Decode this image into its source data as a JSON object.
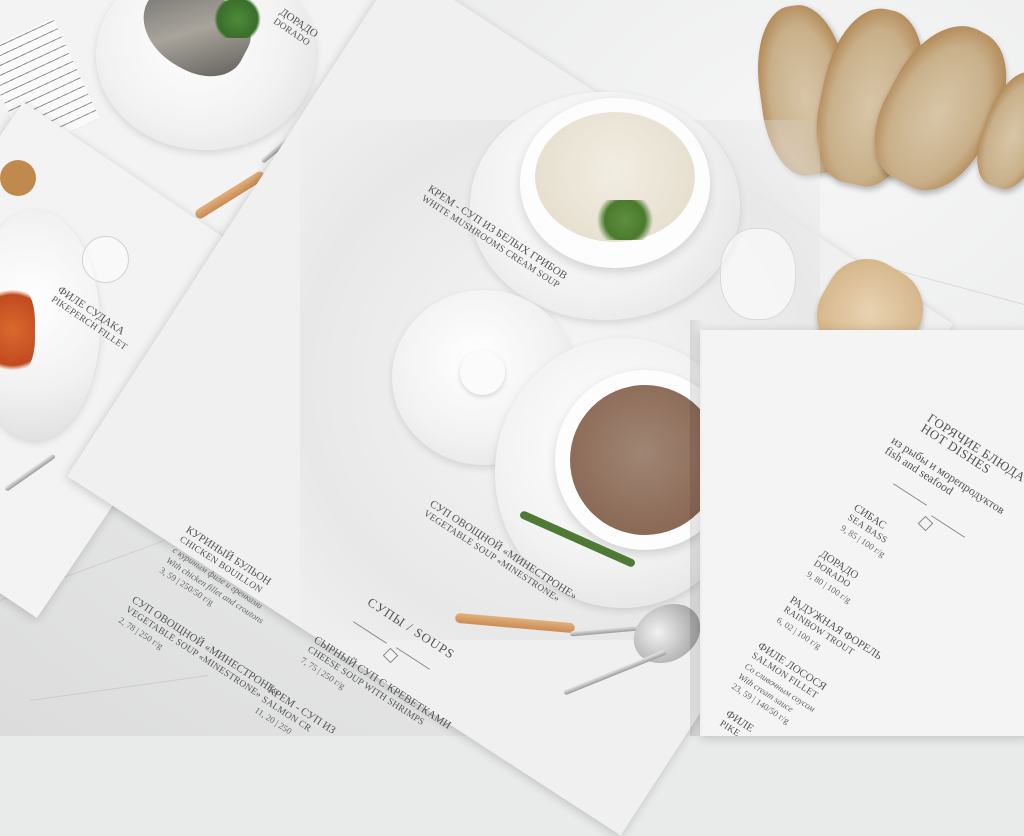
{
  "top_left_page": {
    "dish_ru": "ДОРАДО",
    "dish_en": "DORADO"
  },
  "left_page": {
    "dish_ru": "ФИЛЕ СУДАКА",
    "dish_en": "PIKEPERCH FILLET"
  },
  "center_page": {
    "photo_caption_1_ru": "КРЕМ - СУП ИЗ БЕЛЫХ ГРИБОВ",
    "photo_caption_1_en": "WHITE MUSHROOMS CREAM SOUP",
    "photo_caption_2_ru": "СУП ОВОЩНОЙ «МИНЕСТРОНЕ»",
    "photo_caption_2_en": "VEGETABLE SOUP «MINESTRONE»",
    "section_title": "СУПЫ / SOUPS",
    "items": [
      {
        "ru": "КУРИНЫЙ БУЛЬОН",
        "en": "CHICKEN BOUILLON",
        "desc_ru": "с куриным филе и гренками",
        "desc_en": "With chicken fillet and croutons",
        "price": "3, 59 | 250/50 г/g"
      },
      {
        "ru": "СУП ОВОЩНОЙ «МИНЕСТРОНЕ»",
        "en": "VEGETABLE SOUP «MINESTRONE»",
        "price": "2, 78 | 250 г/g"
      },
      {
        "ru": "СЫРНЫЙ СУП С КРЕВЕТКАМИ",
        "en": "CHEESE SOUP WITH SHRIMPS",
        "price": "7, 75 | 250 г/g"
      },
      {
        "ru": "КРЕМ - СУП ИЗ",
        "en": "SALMON CR",
        "price": "11, 20 | 250"
      }
    ]
  },
  "right_page": {
    "title_ru": "ГОРЯЧИЕ БЛЮДА",
    "title_en": "HOT DISHES",
    "subtitle_ru": "из рыбы и морепродуктов",
    "subtitle_en": "fish and seafood",
    "items": [
      {
        "ru": "СИБАС",
        "en": "SEA BASS",
        "price": "9, 85 | 100 г/g"
      },
      {
        "ru": "ДОРАДО",
        "en": "DORADO",
        "price": "9, 80 | 100 г/g"
      },
      {
        "ru": "РАДУЖНАЯ ФОРЕЛЬ",
        "en": "RAINBOW TROUT",
        "price": "6, 02 | 100 г/g"
      },
      {
        "ru": "ФИЛЕ ЛОСОСЯ",
        "en": "SALMON FILLET",
        "desc_ru": "Со сливочным соусом",
        "desc_en": "With cream sauce",
        "price": "23, 59 | 140/50 г/g"
      },
      {
        "ru": "ФИЛЕ",
        "en": "PIKE"
      }
    ]
  },
  "colors": {
    "page": "#f3f3f3",
    "marble": "#e9eaea",
    "mushroom_soup": "#ece6d8",
    "minestrone": "#8b6a56",
    "bread_crust": "#a8763e",
    "wood_handle": "#d9a26c"
  }
}
